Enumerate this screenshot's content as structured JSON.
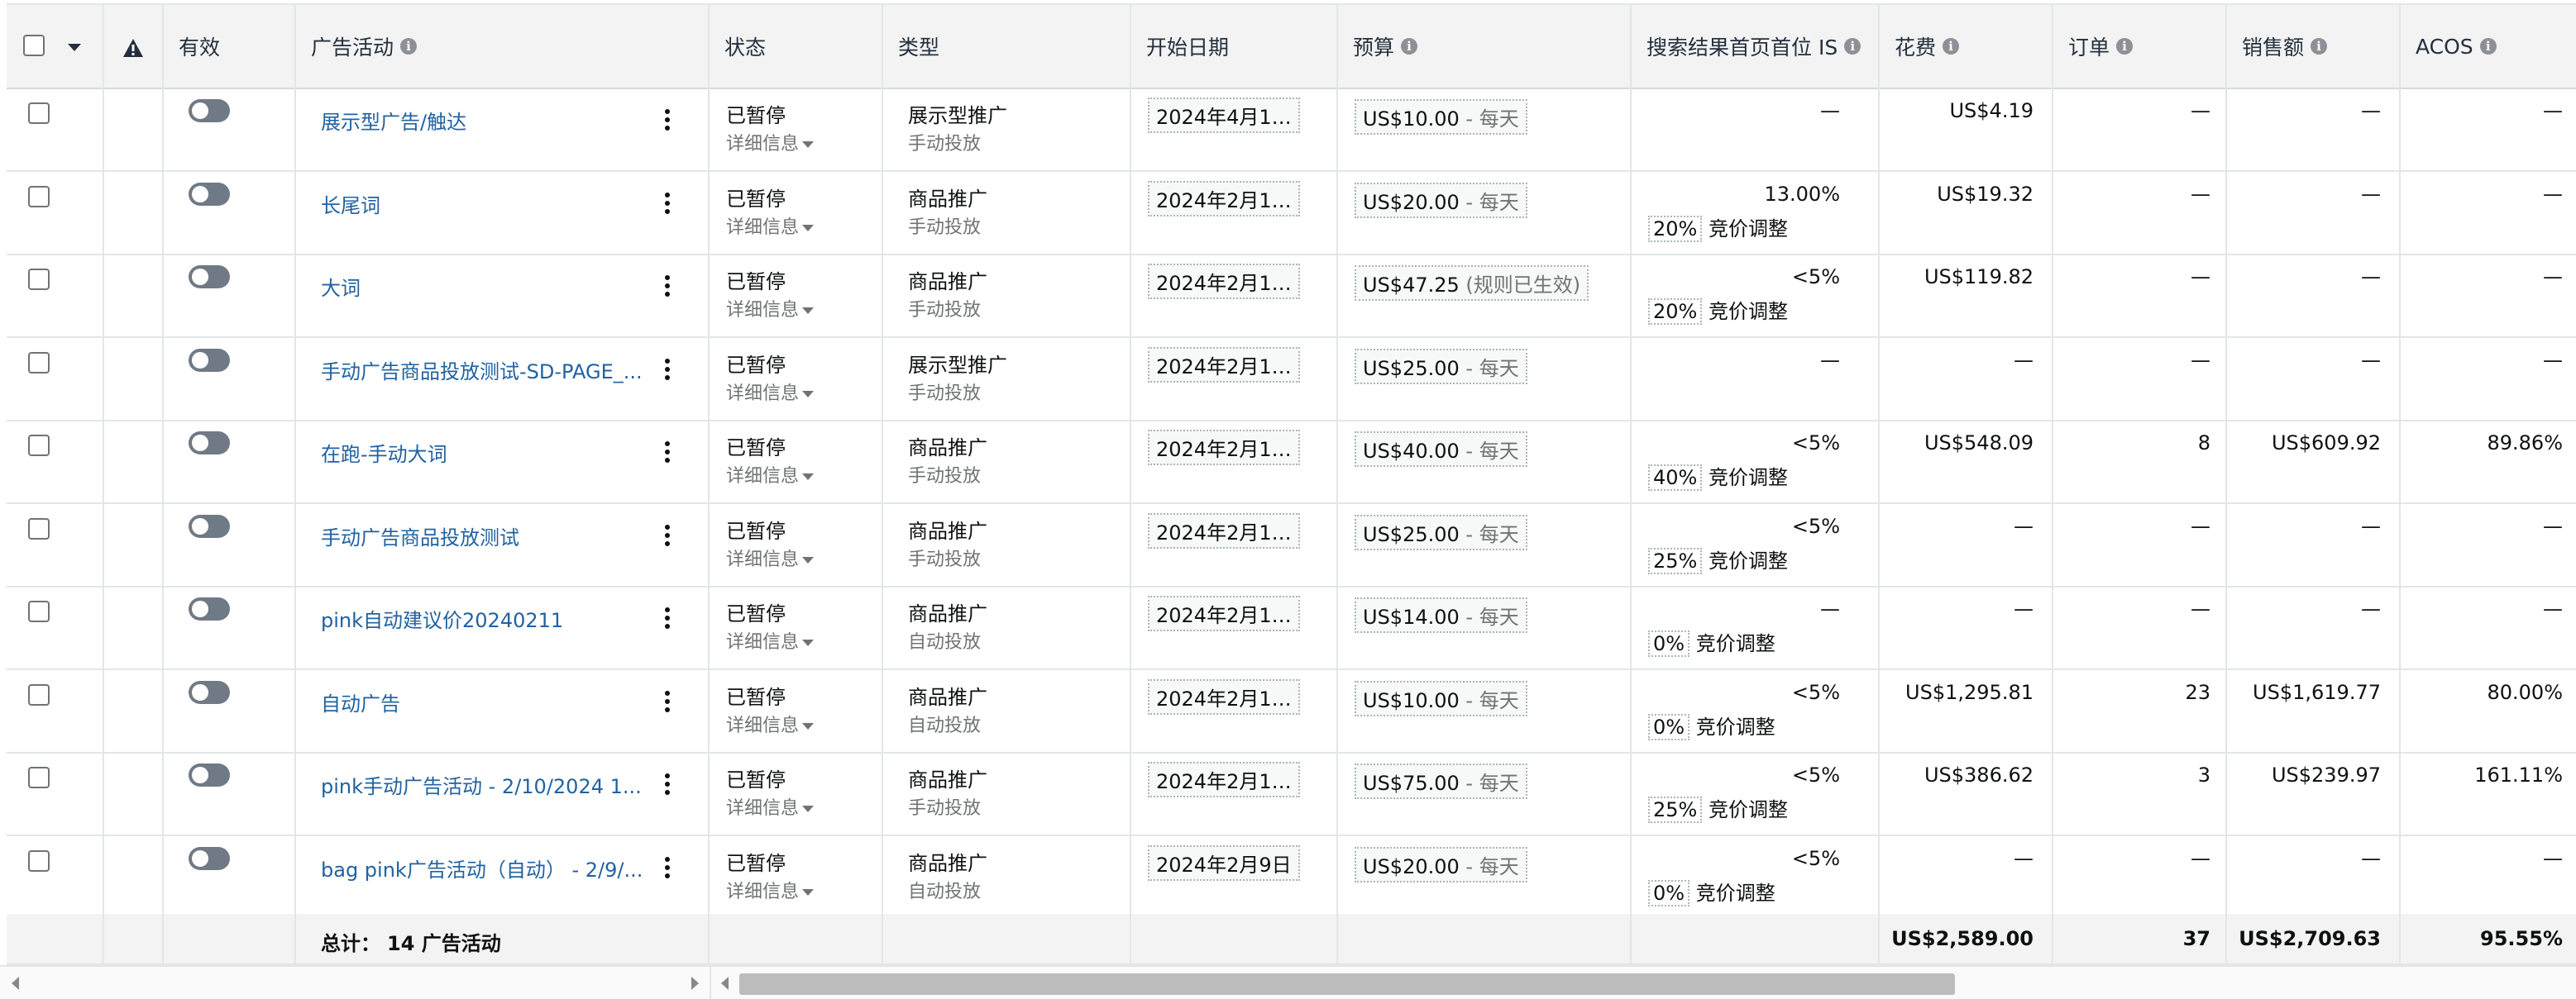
{
  "header": {
    "active": "有效",
    "campaign": "广告活动",
    "status": "状态",
    "type": "类型",
    "start_date": "开始日期",
    "budget": "预算",
    "top_is": "搜索结果首页首位 IS",
    "spend": "花费",
    "orders": "订单",
    "sales": "销售额",
    "acos": "ACOS"
  },
  "icons": {
    "warning": "warning-icon",
    "info": "info-icon",
    "sort_dropdown": "chevron-down-icon",
    "kebab": "more-options-icon",
    "details_caret": "caret-down-icon"
  },
  "colors": {
    "link": "#2162a1",
    "header_bg": "#f3f3f3",
    "toggle_off": "#6f7a86",
    "muted": "#6f7373"
  },
  "rows": [
    {
      "name": "展示型广告/触达",
      "status": "已暂停",
      "details": "详细信息",
      "type": "展示型推广",
      "targeting": "手动投放",
      "date": "2024年4月1…",
      "budget_amount": "US$10.00",
      "budget_suffix": " - 每天",
      "is_pct": "—",
      "bid_pct": "",
      "bid_label": "",
      "spend": "US$4.19",
      "orders": "—",
      "sales": "—",
      "acos": "—"
    },
    {
      "name": "长尾词",
      "status": "已暂停",
      "details": "详细信息",
      "type": "商品推广",
      "targeting": "手动投放",
      "date": "2024年2月1…",
      "budget_amount": "US$20.00",
      "budget_suffix": " - 每天",
      "is_pct": "13.00%",
      "bid_pct": "20%",
      "bid_label": " 竞价调整",
      "spend": "US$19.32",
      "orders": "—",
      "sales": "—",
      "acos": "—"
    },
    {
      "name": "大词",
      "status": "已暂停",
      "details": "详细信息",
      "type": "商品推广",
      "targeting": "手动投放",
      "date": "2024年2月1…",
      "budget_amount": "US$47.25",
      "budget_suffix": " (规则已生效)",
      "is_pct": "<5%",
      "bid_pct": "20%",
      "bid_label": " 竞价调整",
      "spend": "US$119.82",
      "orders": "—",
      "sales": "—",
      "acos": "—"
    },
    {
      "name": "手动广告商品投放测试-SD-PAGE_...",
      "status": "已暂停",
      "details": "详细信息",
      "type": "展示型推广",
      "targeting": "手动投放",
      "date": "2024年2月1…",
      "budget_amount": "US$25.00",
      "budget_suffix": " - 每天",
      "is_pct": "—",
      "bid_pct": "",
      "bid_label": "",
      "spend": "—",
      "orders": "—",
      "sales": "—",
      "acos": "—"
    },
    {
      "name": "在跑-手动大词",
      "status": "已暂停",
      "details": "详细信息",
      "type": "商品推广",
      "targeting": "手动投放",
      "date": "2024年2月1…",
      "budget_amount": "US$40.00",
      "budget_suffix": " - 每天",
      "is_pct": "<5%",
      "bid_pct": "40%",
      "bid_label": " 竞价调整",
      "spend": "US$548.09",
      "orders": "8",
      "sales": "US$609.92",
      "acos": "89.86%"
    },
    {
      "name": "手动广告商品投放测试",
      "status": "已暂停",
      "details": "详细信息",
      "type": "商品推广",
      "targeting": "手动投放",
      "date": "2024年2月1…",
      "budget_amount": "US$25.00",
      "budget_suffix": " - 每天",
      "is_pct": "<5%",
      "bid_pct": "25%",
      "bid_label": " 竞价调整",
      "spend": "—",
      "orders": "—",
      "sales": "—",
      "acos": "—"
    },
    {
      "name": "pink自动建议价20240211",
      "status": "已暂停",
      "details": "详细信息",
      "type": "商品推广",
      "targeting": "自动投放",
      "date": "2024年2月1…",
      "budget_amount": "US$14.00",
      "budget_suffix": " - 每天",
      "is_pct": "—",
      "bid_pct": "0%",
      "bid_label": " 竞价调整",
      "spend": "—",
      "orders": "—",
      "sales": "—",
      "acos": "—"
    },
    {
      "name": "自动广告",
      "status": "已暂停",
      "details": "详细信息",
      "type": "商品推广",
      "targeting": "自动投放",
      "date": "2024年2月1…",
      "budget_amount": "US$10.00",
      "budget_suffix": " - 每天",
      "is_pct": "<5%",
      "bid_pct": "0%",
      "bid_label": " 竞价调整",
      "spend": "US$1,295.81",
      "orders": "23",
      "sales": "US$1,619.77",
      "acos": "80.00%"
    },
    {
      "name": "pink手动广告活动 - 2/10/2024 1...",
      "status": "已暂停",
      "details": "详细信息",
      "type": "商品推广",
      "targeting": "手动投放",
      "date": "2024年2月1…",
      "budget_amount": "US$75.00",
      "budget_suffix": " - 每天",
      "is_pct": "<5%",
      "bid_pct": "25%",
      "bid_label": " 竞价调整",
      "spend": "US$386.62",
      "orders": "3",
      "sales": "US$239.97",
      "acos": "161.11%"
    },
    {
      "name": "bag pink广告活动（自动） - 2/9/...",
      "status": "已暂停",
      "details": "详细信息",
      "type": "商品推广",
      "targeting": "自动投放",
      "date": "2024年2月9日",
      "budget_amount": "US$20.00",
      "budget_suffix": " - 每天",
      "is_pct": "<5%",
      "bid_pct": "0%",
      "bid_label": " 竞价调整",
      "spend": "—",
      "orders": "—",
      "sales": "—",
      "acos": "—"
    }
  ],
  "footer": {
    "total_label": "总计：",
    "total_count": "14 广告活动",
    "spend": "US$2,589.00",
    "orders": "37",
    "sales": "US$2,709.63",
    "acos": "95.55%"
  }
}
